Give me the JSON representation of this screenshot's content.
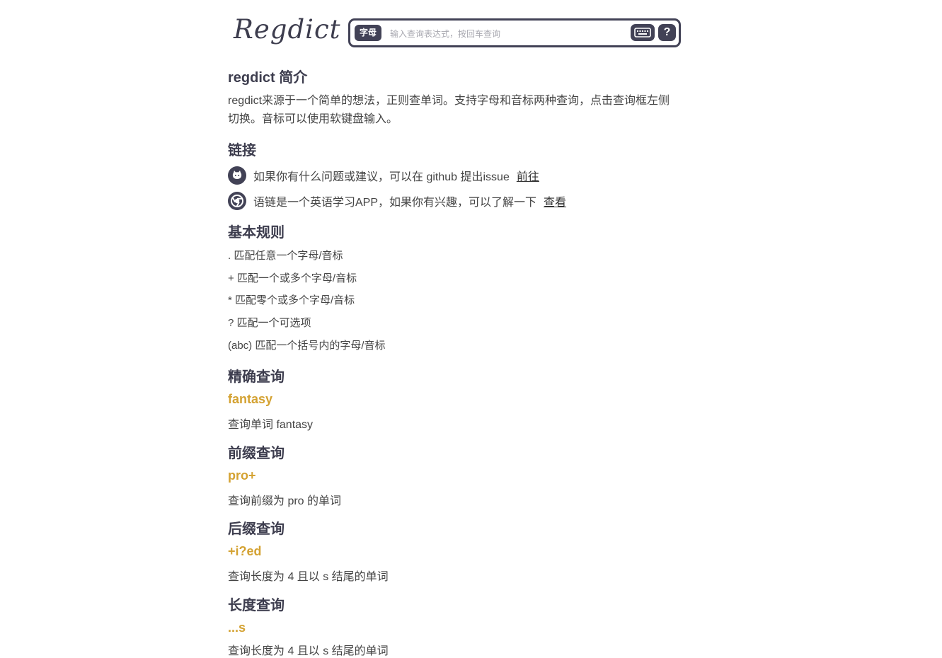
{
  "header": {
    "logo": "Regdict",
    "mode_label": "字母",
    "search_placeholder": "输入查询表达式，按回车查询",
    "help_label": "?"
  },
  "intro": {
    "title": "regdict 简介",
    "text": "regdict来源于一个简单的想法，正则查单词。支持字母和音标两种查询，点击查询框左侧切换。音标可以使用软键盘输入。"
  },
  "links": {
    "title": "链接",
    "items": [
      {
        "icon": "github-icon",
        "text": "如果你有什么问题或建议，可以在 github 提出issue",
        "action": "前往"
      },
      {
        "icon": "chrome-icon",
        "text": "语链是一个英语学习APP，如果你有兴趣，可以了解一下",
        "action": "查看"
      }
    ]
  },
  "rules": {
    "title": "基本规则",
    "items": [
      ". 匹配任意一个字母/音标",
      "+ 匹配一个或多个字母/音标",
      "* 匹配零个或多个字母/音标",
      "? 匹配一个可选项",
      "(abc) 匹配一个括号内的字母/音标"
    ]
  },
  "sections": [
    {
      "title": "精确查询",
      "example": "fantasy",
      "desc": "查询单词 fantasy"
    },
    {
      "title": "前缀查询",
      "example": "pro+",
      "desc": "查询前缀为 pro 的单词"
    },
    {
      "title": "后缀查询",
      "example": "+i?ed",
      "desc": "查询长度为 4 且以 s 结尾的单词"
    },
    {
      "title": "长度查询",
      "example": "...s",
      "desc": "查询长度为 4 且以 s 结尾的单词"
    }
  ],
  "colors": {
    "accent": "#d4a232",
    "dark": "#424256"
  }
}
